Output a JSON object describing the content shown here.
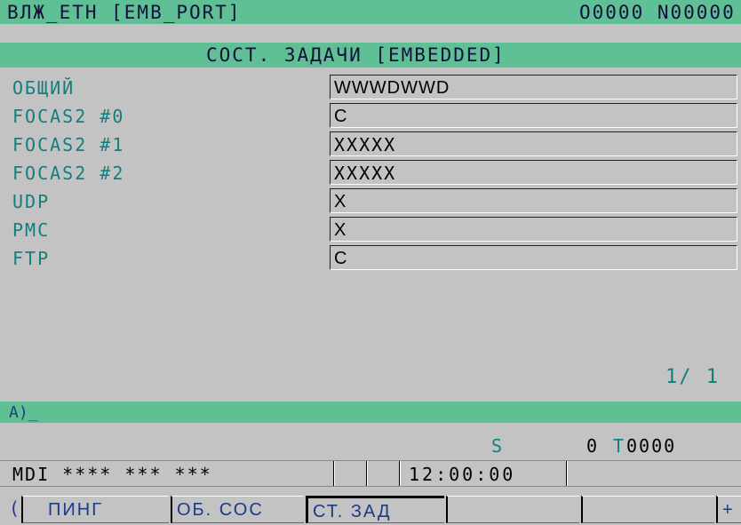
{
  "header": {
    "left": "ВЛЖ_ETH  [EMB_PORT]",
    "right": "O0000 N00000"
  },
  "subheader": {
    "title": "СОСТ. ЗАДАЧИ [EMBEDDED]"
  },
  "rows": [
    {
      "label": "ОБЩИЙ",
      "value": "WWWDWWD"
    },
    {
      "label": "FOCAS2  #0",
      "value": "C"
    },
    {
      "label": "FOCAS2  #1",
      "value": "XXXXX"
    },
    {
      "label": "FOCAS2  #2",
      "value": "XXXXX"
    },
    {
      "label": "UDP",
      "value": "X"
    },
    {
      "label": "PMC",
      "value": "X"
    },
    {
      "label": "FTP",
      "value": "C"
    }
  ],
  "page_indicator": "1/  1",
  "prompt": "A)_",
  "spindle": {
    "label": "S",
    "value": "0",
    "t_label": "T",
    "t_value": "0000"
  },
  "status": {
    "mode": "MDI   ****  ***  ***",
    "time": "12:00:00"
  },
  "softkeys": {
    "left_arrow": "(",
    "items": [
      "ПИНГ",
      "ОБ. СОС",
      "СТ. ЗАД",
      "",
      ""
    ],
    "right_arrow": "+"
  }
}
